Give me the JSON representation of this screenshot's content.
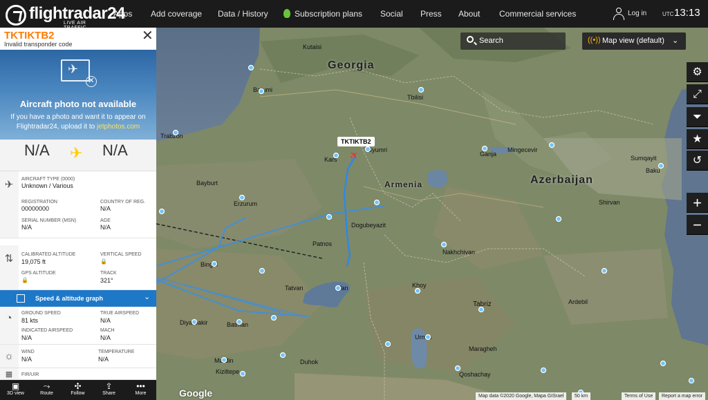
{
  "topbar": {
    "logo_text": "flightradar24",
    "logo_tagline": "LIVE AIR TRAFFIC",
    "nav": [
      "Apps",
      "Add coverage",
      "Data / History",
      "Subscription plans",
      "Social",
      "Press",
      "About",
      "Commercial services"
    ],
    "login": "Log in",
    "utc_label": "UTC",
    "time": "13:13"
  },
  "sidebar": {
    "callsign": "TKTIKTB2",
    "squawk_note": "Invalid transponder code",
    "photo_title": "Aircraft photo not available",
    "photo_text": "If you have a photo and want it to appear on Flightradar24, upload it to",
    "photo_link": "jetphotos.com",
    "origin": "N/A",
    "destination": "N/A",
    "aircraft_type_label": "AIRCRAFT TYPE",
    "aircraft_type_code": "(0000)",
    "aircraft_type_value": "Unknown / Various",
    "registration_label": "REGISTRATION",
    "registration_value": "00000000",
    "country_label": "COUNTRY OF REG.",
    "country_value": "N/A",
    "serial_label": "SERIAL NUMBER (MSN)",
    "serial_value": "N/A",
    "age_label": "AGE",
    "age_value": "N/A",
    "cal_alt_label": "CALIBRATED ALTITUDE",
    "cal_alt_value": "19,075 ft",
    "vspeed_label": "VERTICAL SPEED",
    "gps_alt_label": "GPS ALTITUDE",
    "track_label": "TRACK",
    "track_value": "321°",
    "graph_label": "Speed & altitude graph",
    "ground_speed_label": "GROUND SPEED",
    "ground_speed_value": "81 kts",
    "true_airspeed_label": "TRUE AIRSPEED",
    "true_airspeed_value": "N/A",
    "indicated_label": "INDICATED AIRSPEED",
    "indicated_value": "N/A",
    "mach_label": "MACH",
    "mach_value": "N/A",
    "wind_label": "WIND",
    "wind_value": "N/A",
    "temp_label": "TEMPERATURE",
    "temp_value": "N/A",
    "fir_label": "FIR/UIR",
    "bottom": [
      "3D view",
      "Route",
      "Follow",
      "Share",
      "More"
    ]
  },
  "map": {
    "search_label": "Search",
    "map_view_label": "Map view (default)",
    "flight_label": "TKTIKTB2",
    "countries": [
      "Georgia",
      "Armenia",
      "Azerbaijan"
    ],
    "cities": [
      "Kutaisi",
      "Batumi",
      "Tbilisi",
      "Trabzon",
      "Kars",
      "Gyumri",
      "Ganja",
      "Mingecevir",
      "Sumqayit",
      "Baku",
      "Bayburt",
      "Erzurum",
      "Dogubeyazit",
      "Shirvan",
      "Patnos",
      "Nakhchivan",
      "Bingol",
      "Tatvan",
      "Khoy",
      "Tabriz",
      "Diyarbakir",
      "Batman",
      "Van",
      "Urmia",
      "Maragheh",
      "Mardin",
      "Duhok",
      "Kiziltepe",
      "Qoshachay",
      "Ardebil"
    ],
    "google": "Google",
    "attribution": "Map data ©2020 Google, Mapa GISrael",
    "scale": "50 km",
    "terms": "Terms of Use",
    "report": "Report a map error"
  },
  "colors": {
    "accent_orange": "#ff7b00",
    "track_blue": "#1e78c8",
    "plane_red": "#e53935",
    "topbar": "#1b1b1b"
  }
}
